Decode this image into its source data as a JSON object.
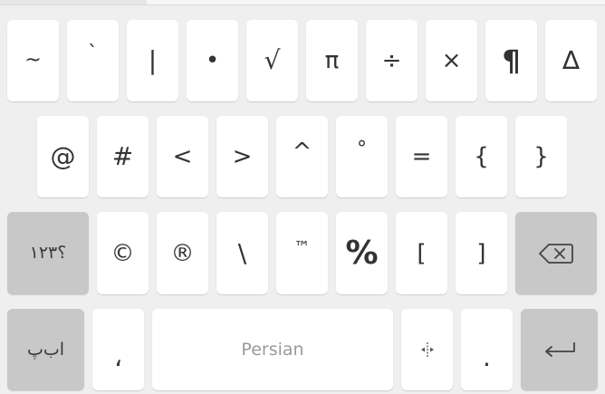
{
  "keyboard": {
    "row1": [
      "~",
      "`",
      "|",
      "•",
      "√",
      "π",
      "÷",
      "×",
      "¶",
      "∆"
    ],
    "row2": [
      "@",
      "#",
      "<",
      ">",
      "^",
      "°",
      "=",
      "{",
      "}"
    ],
    "row3": {
      "layout_switch": "؟۱۲۳",
      "keys": [
        "©",
        "®",
        "\\",
        "™",
        "%",
        "[",
        "]"
      ],
      "backspace_icon": "backspace-icon"
    },
    "row4": {
      "alphabet_switch": "اب‌پ",
      "comma": "،",
      "space_label": "Persian",
      "cursor_icon": "cursor-move-icon",
      "period": ".",
      "enter_icon": "enter-icon"
    },
    "colors": {
      "background": "#efefef",
      "key": "#ffffff",
      "function_key": "#c8c8c8",
      "text": "#333333",
      "space_text": "#9a9a9a"
    }
  }
}
